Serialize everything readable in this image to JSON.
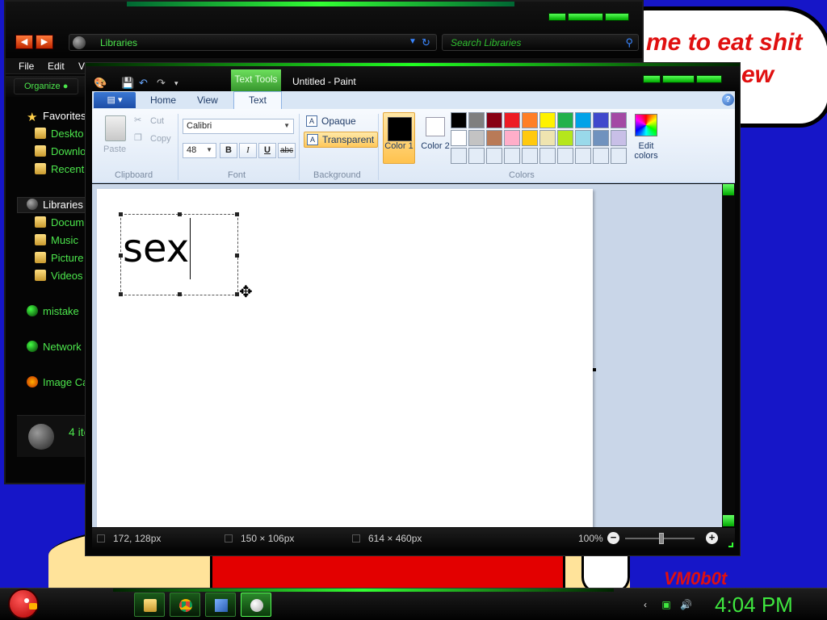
{
  "wallpaper": {
    "bubble_lines": [
      "me to eat shit",
      "ew"
    ],
    "signature": "VM0b0t"
  },
  "explorer": {
    "address": "Libraries",
    "search_placeholder": "Search Libraries",
    "menu": [
      "File",
      "Edit",
      "Vi"
    ],
    "organize_label": "Organize",
    "nav_items": [
      {
        "label": "Favorites",
        "icon": "star-icon"
      },
      {
        "label": "Deskto",
        "icon": "desktop-folder-icon"
      },
      {
        "label": "Downlo",
        "icon": "downloads-folder-icon"
      },
      {
        "label": "Recent",
        "icon": "recent-places-icon"
      },
      {
        "label": "Libraries",
        "icon": "libraries-icon"
      },
      {
        "label": "Docum",
        "icon": "documents-folder-icon"
      },
      {
        "label": "Music",
        "icon": "music-folder-icon"
      },
      {
        "label": "Picture",
        "icon": "pictures-folder-icon"
      },
      {
        "label": "Videos",
        "icon": "videos-folder-icon"
      },
      {
        "label": "mistake",
        "icon": "homegroup-icon"
      },
      {
        "label": "Network",
        "icon": "network-icon"
      },
      {
        "label": "Image Ca",
        "icon": "image-capture-icon"
      }
    ],
    "item_count": "4 ite"
  },
  "paint": {
    "contextual_tab": "Text Tools",
    "window_title": "Untitled - Paint",
    "tabs": [
      "Home",
      "View",
      "Text"
    ],
    "active_tab": "Text",
    "clipboard": {
      "paste": "Paste",
      "cut": "Cut",
      "copy": "Copy",
      "group": "Clipboard"
    },
    "font": {
      "family": "Calibri",
      "size": "48",
      "bold": "B",
      "italic": "I",
      "underline": "U",
      "strike": "abc",
      "group": "Font"
    },
    "background": {
      "opaque": "Opaque",
      "transparent": "Transparent",
      "selected": "Transparent",
      "group": "Background"
    },
    "colors": {
      "color1_label": "Color 1",
      "color2_label": "Color 2",
      "edit_label": "Edit colors",
      "group": "Colors",
      "color1": "#000000",
      "color2": "#ffffff",
      "palette_row1": [
        "#000000",
        "#7f7f7f",
        "#880015",
        "#ed1c24",
        "#ff7f27",
        "#fff200",
        "#22b14c",
        "#00a2e8",
        "#3f48cc",
        "#a349a4"
      ],
      "palette_row2": [
        "#ffffff",
        "#c3c3c3",
        "#b97a57",
        "#ffaec9",
        "#ffc90e",
        "#efe4b0",
        "#b5e61d",
        "#99d9ea",
        "#7092be",
        "#c8bfe7"
      ],
      "palette_row3": [
        "#e3ecf7",
        "#e3ecf7",
        "#e3ecf7",
        "#e3ecf7",
        "#e3ecf7",
        "#e3ecf7",
        "#e3ecf7",
        "#e3ecf7",
        "#e3ecf7",
        "#e3ecf7"
      ]
    },
    "canvas_text": "sex",
    "status": {
      "cursor_pos": "172, 128px",
      "selection_size": "150 × 106px",
      "image_size": "614 × 460px",
      "zoom": "100%"
    }
  },
  "taskbar": {
    "clock": "4:04 PM",
    "pinned": [
      "explorer-icon",
      "chrome-icon",
      "windows-tools-icon",
      "paint-icon"
    ]
  },
  "theme": {
    "accent_green": "#3fe83f",
    "wallpaper_blue": "#1616c8"
  }
}
